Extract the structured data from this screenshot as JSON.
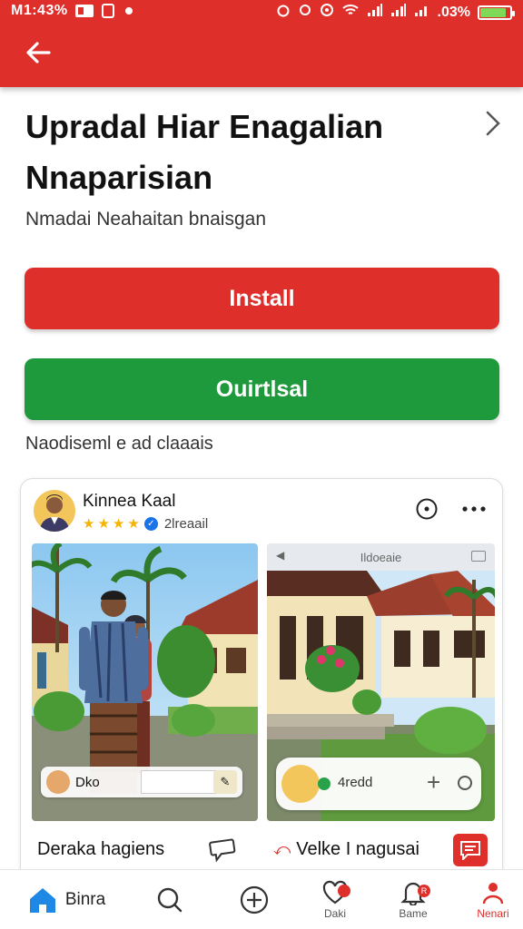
{
  "status_bar": {
    "time": "M1:43%",
    "battery_text": ".03%"
  },
  "header": {
    "back_icon": "back-arrow-icon"
  },
  "app": {
    "title": "Upradal Hiar Enagalian Nnaparisian",
    "subtitle": "Nmadai Neahaitan bnaisgan",
    "install_label": "Install",
    "secondary_label": "Ouirtlsal",
    "note": "Naodiseml e ad claaais"
  },
  "card": {
    "author_name": "Kinnea Kaal",
    "rating_count": "2lreaail",
    "left_photo_tag": "Dko",
    "right_photo_bar": "Ildoeaie",
    "right_photo_overlay": "4redd",
    "footer_left": "Deraka hagiens",
    "footer_right": "Velke I nagusai"
  },
  "bottom_nav": {
    "items": [
      {
        "label": "Binra",
        "icon": "home-icon"
      },
      {
        "label": "",
        "icon": "search-icon"
      },
      {
        "label": "",
        "icon": "add-icon"
      },
      {
        "label": "Daki",
        "icon": "heart-icon"
      },
      {
        "label": "Bame",
        "icon": "bell-icon"
      },
      {
        "label": "Nenari",
        "icon": "profile-icon"
      }
    ]
  },
  "colors": {
    "brand_red": "#de2f2b",
    "action_green": "#1e9a3c",
    "home_blue": "#1e88e5"
  }
}
